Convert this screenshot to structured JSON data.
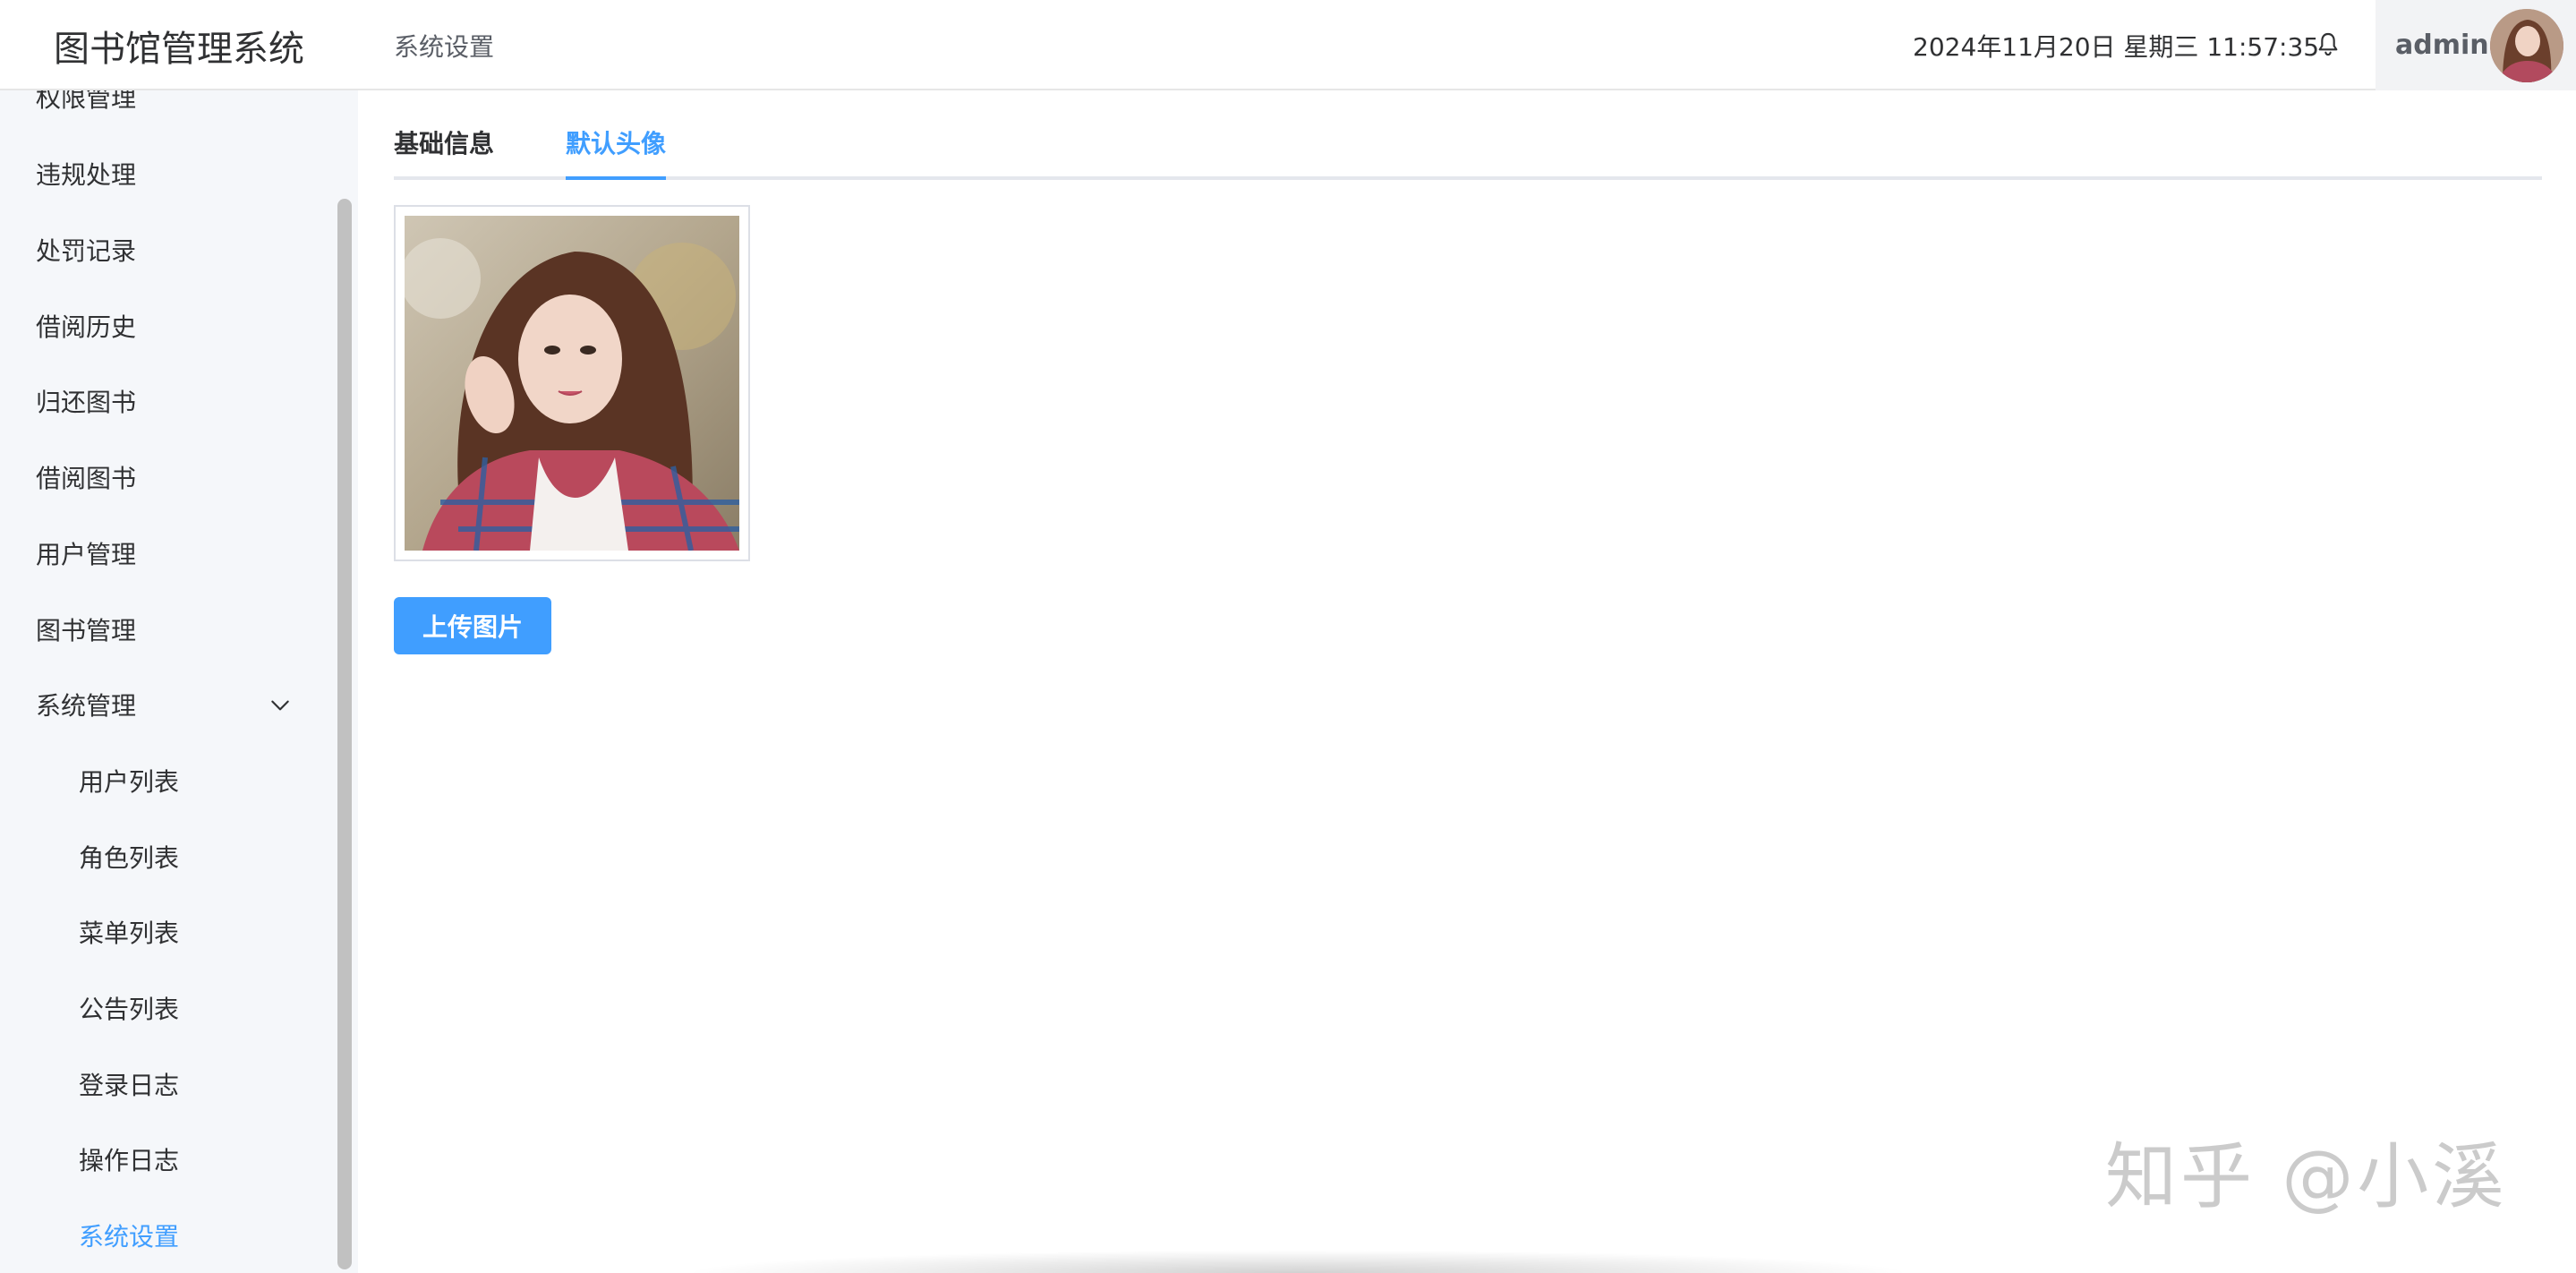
{
  "header": {
    "app_title": "图书馆管理系统",
    "breadcrumb": "系统设置",
    "datetime": "2024年11月20日 星期三 11:57:35",
    "username": "admin"
  },
  "sidebar": {
    "items": [
      {
        "label": "权限管理"
      },
      {
        "label": "违规处理"
      },
      {
        "label": "处罚记录"
      },
      {
        "label": "借阅历史"
      },
      {
        "label": "归还图书"
      },
      {
        "label": "借阅图书"
      },
      {
        "label": "用户管理"
      },
      {
        "label": "图书管理"
      },
      {
        "label": "系统管理",
        "expanded": true
      },
      {
        "label": "用户列表"
      },
      {
        "label": "角色列表"
      },
      {
        "label": "菜单列表"
      },
      {
        "label": "公告列表"
      },
      {
        "label": "登录日志"
      },
      {
        "label": "操作日志"
      },
      {
        "label": "系统设置",
        "active": true
      }
    ]
  },
  "main": {
    "tabs": [
      {
        "label": "基础信息"
      },
      {
        "label": "默认头像",
        "active": true
      }
    ],
    "upload_label": "上传图片"
  },
  "watermark": "知乎 @小溪",
  "colors": {
    "accent": "#409eff",
    "sidebar_bg": "#f5f7fa",
    "text": "#303133"
  }
}
